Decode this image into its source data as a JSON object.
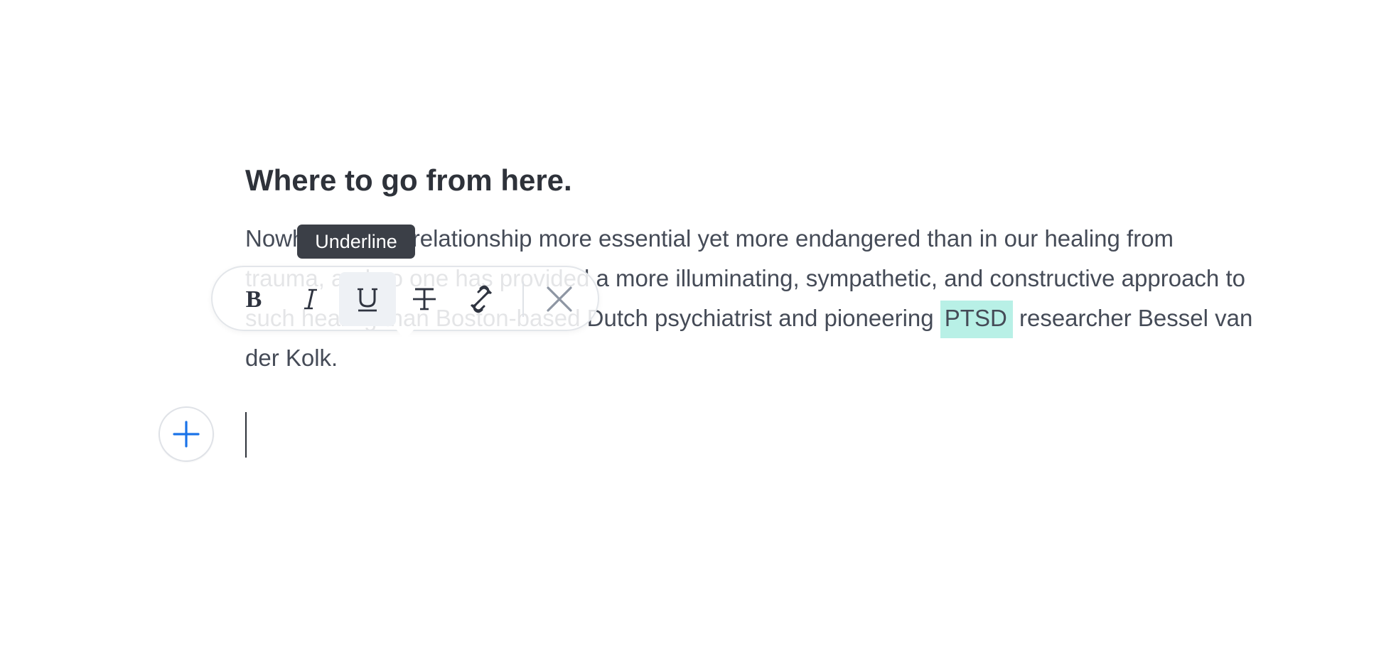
{
  "document": {
    "heading": "Where to go from here.",
    "paragraph_before": "Nowhere is this relationship more essential yet more endangered than in our healing from trauma, and no one has provided a more illuminating, sympathetic, and constructive approach to such healing than Boston-based Dutch psychiatrist and pioneering ",
    "paragraph_selected": "PTSD",
    "paragraph_after": " researcher Bessel van der Kolk."
  },
  "toolbar": {
    "tooltip": "Underline",
    "buttons": [
      {
        "name": "bold",
        "icon": "bold-icon",
        "active": false
      },
      {
        "name": "italic",
        "icon": "italic-icon",
        "active": false
      },
      {
        "name": "underline",
        "icon": "underline-icon",
        "active": true
      },
      {
        "name": "strikethrough",
        "icon": "strikethrough-icon",
        "active": false
      },
      {
        "name": "link",
        "icon": "link-icon",
        "active": false
      },
      {
        "name": "close",
        "icon": "close-icon",
        "active": false
      }
    ]
  },
  "add_block": {
    "icon": "plus-icon"
  },
  "colors": {
    "selection_highlight": "#b8f0e6",
    "accent": "#1a73e8",
    "text": "#454b57",
    "tooltip_bg": "#3b3f47"
  }
}
